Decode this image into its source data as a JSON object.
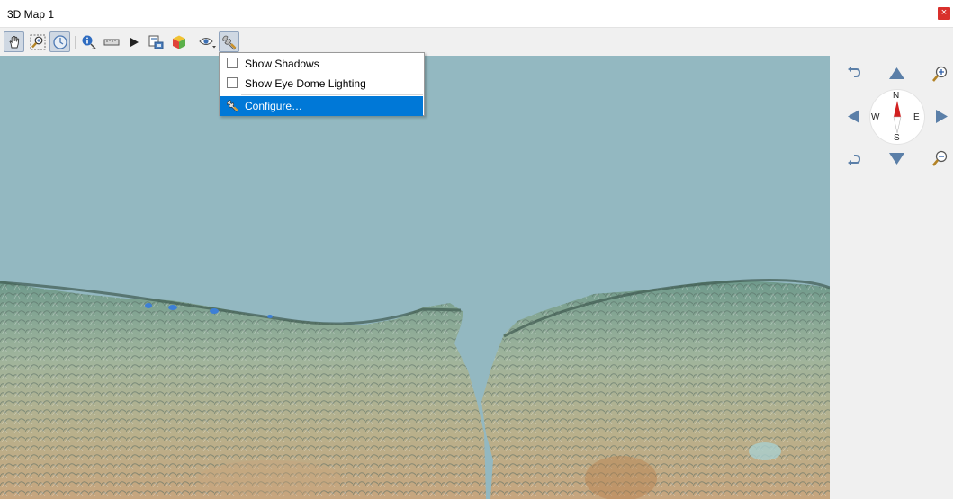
{
  "window": {
    "title": "3D Map 1",
    "close_glyph": "×"
  },
  "toolbar": {
    "buttons": [
      {
        "icon": "pan-hand-icon",
        "active": true
      },
      {
        "icon": "zoom-full-icon",
        "active": false
      },
      {
        "icon": "camera-rotate-icon",
        "active": true
      },
      {
        "icon": "identify-icon",
        "active": false
      },
      {
        "icon": "measure-line-icon",
        "active": false
      },
      {
        "icon": "play-animation-icon",
        "active": false
      },
      {
        "icon": "save-image-icon",
        "active": false
      },
      {
        "icon": "export-scene-icon",
        "active": false
      },
      {
        "icon": "eye-dropdown-icon",
        "active": false
      },
      {
        "icon": "wrench-options-icon",
        "active": true
      }
    ]
  },
  "options_menu": {
    "items": [
      {
        "label": "Show Shadows",
        "type": "checkbox",
        "checked": false
      },
      {
        "label": "Show Eye Dome Lighting",
        "type": "checkbox",
        "checked": false
      },
      {
        "label": "Configure…",
        "type": "action",
        "icon": "wrench-icon",
        "highlighted": true
      }
    ]
  },
  "navigation": {
    "compass": {
      "north": "N",
      "south": "S",
      "east": "E",
      "west": "W"
    }
  },
  "colors": {
    "water": "#93b8c1",
    "menu_highlight": "#0078d7",
    "compass_needle": "#d22020",
    "nav_arrow": "#5b7fa8"
  }
}
